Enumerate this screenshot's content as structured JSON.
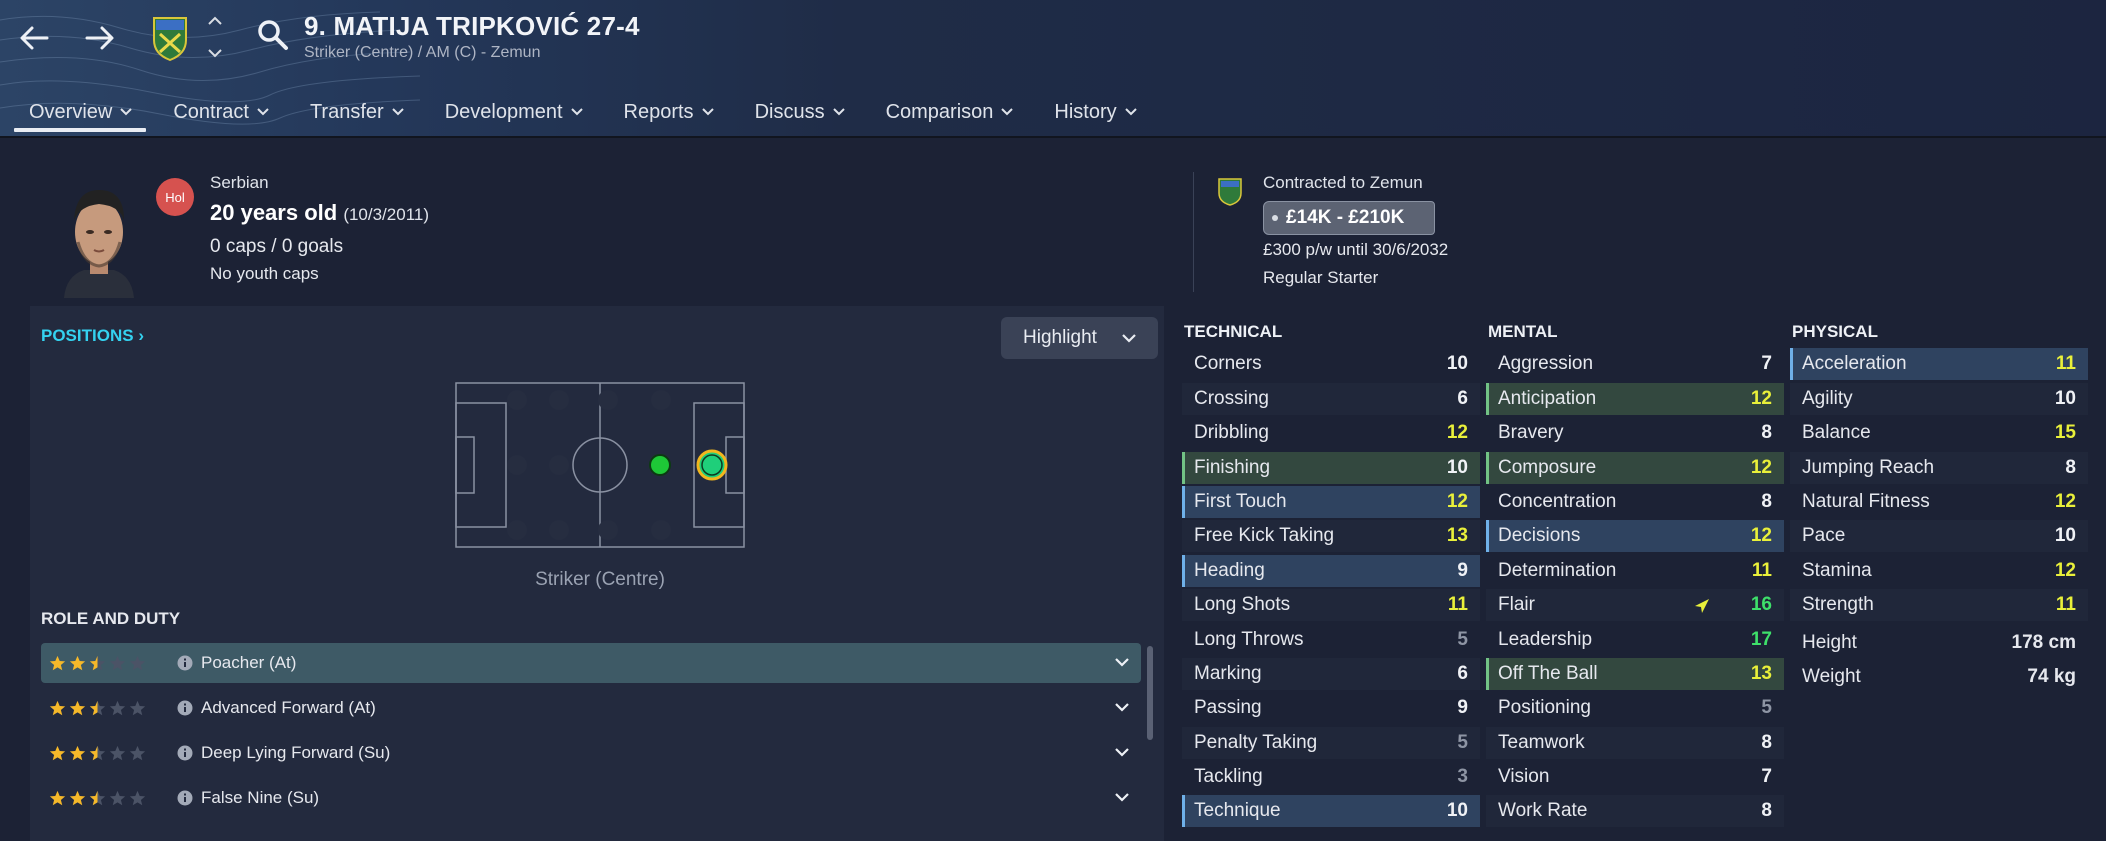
{
  "header": {
    "title": "9. MATIJA TRIPKOVIĆ 27-4",
    "subtitle": "Striker (Centre) / AM (C) - Zemun",
    "tabs": [
      {
        "label": "Overview"
      },
      {
        "label": "Contract"
      },
      {
        "label": "Transfer"
      },
      {
        "label": "Development"
      },
      {
        "label": "Reports"
      },
      {
        "label": "Discuss"
      },
      {
        "label": "Comparison"
      },
      {
        "label": "History"
      }
    ],
    "active_tab": "Overview"
  },
  "player": {
    "nationality": "Serbian",
    "status_badge": "Hol",
    "age": "20 years old",
    "dob": "(10/3/2011)",
    "caps": "0 caps / 0 goals",
    "youth_caps": "No youth caps"
  },
  "contract": {
    "club": "Contracted to Zemun",
    "value": "£14K - £210K",
    "wage": "£300 p/w until 30/6/2032",
    "squad_status": "Regular Starter"
  },
  "positions": {
    "label": "POSITIONS",
    "highlight_label": "Highlight",
    "position_name": "Striker (Centre)"
  },
  "role_duty": {
    "label": "ROLE AND DUTY",
    "roles": [
      {
        "name": "Poacher (At)",
        "stars": 2.5
      },
      {
        "name": "Advanced Forward (At)",
        "stars": 2.5
      },
      {
        "name": "Deep Lying Forward (Su)",
        "stars": 2.5
      },
      {
        "name": "False Nine (Su)",
        "stars": 2.5
      }
    ]
  },
  "technical": {
    "label": "TECHNICAL",
    "attrs": [
      {
        "name": "Corners",
        "value": "10"
      },
      {
        "name": "Crossing",
        "value": "6"
      },
      {
        "name": "Dribbling",
        "value": "12"
      },
      {
        "name": "Finishing",
        "value": "10"
      },
      {
        "name": "First Touch",
        "value": "12"
      },
      {
        "name": "Free Kick Taking",
        "value": "13"
      },
      {
        "name": "Heading",
        "value": "9"
      },
      {
        "name": "Long Shots",
        "value": "11"
      },
      {
        "name": "Long Throws",
        "value": "5"
      },
      {
        "name": "Marking",
        "value": "6"
      },
      {
        "name": "Passing",
        "value": "9"
      },
      {
        "name": "Penalty Taking",
        "value": "5"
      },
      {
        "name": "Tackling",
        "value": "3"
      },
      {
        "name": "Technique",
        "value": "10"
      }
    ]
  },
  "mental": {
    "label": "MENTAL",
    "attrs": [
      {
        "name": "Aggression",
        "value": "7"
      },
      {
        "name": "Anticipation",
        "value": "12"
      },
      {
        "name": "Bravery",
        "value": "8"
      },
      {
        "name": "Composure",
        "value": "12"
      },
      {
        "name": "Concentration",
        "value": "8"
      },
      {
        "name": "Decisions",
        "value": "12"
      },
      {
        "name": "Determination",
        "value": "11"
      },
      {
        "name": "Flair",
        "value": "16"
      },
      {
        "name": "Leadership",
        "value": "17"
      },
      {
        "name": "Off The Ball",
        "value": "13"
      },
      {
        "name": "Positioning",
        "value": "5"
      },
      {
        "name": "Teamwork",
        "value": "8"
      },
      {
        "name": "Vision",
        "value": "7"
      },
      {
        "name": "Work Rate",
        "value": "8"
      }
    ]
  },
  "physical": {
    "label": "PHYSICAL",
    "attrs": [
      {
        "name": "Acceleration",
        "value": "11"
      },
      {
        "name": "Agility",
        "value": "10"
      },
      {
        "name": "Balance",
        "value": "15"
      },
      {
        "name": "Jumping Reach",
        "value": "8"
      },
      {
        "name": "Natural Fitness",
        "value": "12"
      },
      {
        "name": "Pace",
        "value": "10"
      },
      {
        "name": "Stamina",
        "value": "12"
      },
      {
        "name": "Strength",
        "value": "11"
      }
    ],
    "height_label": "Height",
    "height": "178 cm",
    "weight_label": "Weight",
    "weight": "74 kg"
  },
  "colors": {
    "accent": "#34d2f0",
    "value_high": "#3ee06a",
    "value_good": "#e9f03a",
    "value_low": "#8e95a4"
  }
}
